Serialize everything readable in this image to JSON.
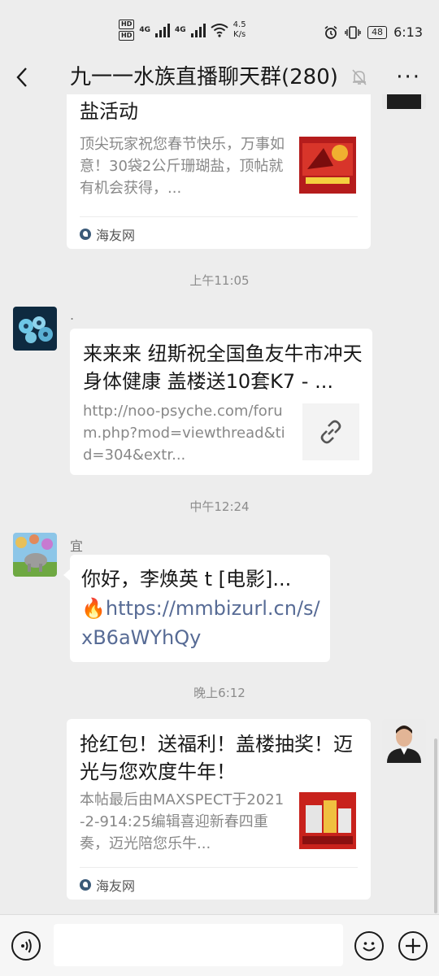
{
  "status_bar": {
    "hd1": "HD",
    "hd2": "HD",
    "net1": "4G",
    "net2": "4G",
    "speed_value": "4.5",
    "speed_unit": "K/s",
    "battery": "48",
    "time": "6:13"
  },
  "header": {
    "title": "九一一水族直播聊天群(280)",
    "more": "···"
  },
  "messages": {
    "m1": {
      "title": "盐活动",
      "desc": "顶尖玩家祝您春节快乐，万事如意！30袋2公斤珊瑚盐，顶帖就有机会获得，...",
      "source": "海友网"
    },
    "t1": "上午11:05",
    "m2": {
      "sender": ".",
      "title": "来来来 纽斯祝全国鱼友牛市冲天 身体健康 盖楼送10套K7 - ...",
      "url": "http://noo-psyche.com/forum.php?mod=viewthread&tid=304&extr..."
    },
    "t2": "中午12:24",
    "m3": {
      "sender": "宜",
      "text": "你好，李焕英 t [电影]...",
      "emoji": "🔥",
      "link": "https://mmbizurl.cn/s/xB6aWYhQy"
    },
    "t3": "晚上6:12",
    "m4": {
      "title": "抢红包！送福利！盖楼抽奖！迈光与您欢度牛年！",
      "desc": "本帖最后由MAXSPECT于2021-2-914:25编辑喜迎新春四重奏，迈光陪您乐牛...",
      "source": "海友网"
    }
  },
  "input": {
    "placeholder": ""
  }
}
